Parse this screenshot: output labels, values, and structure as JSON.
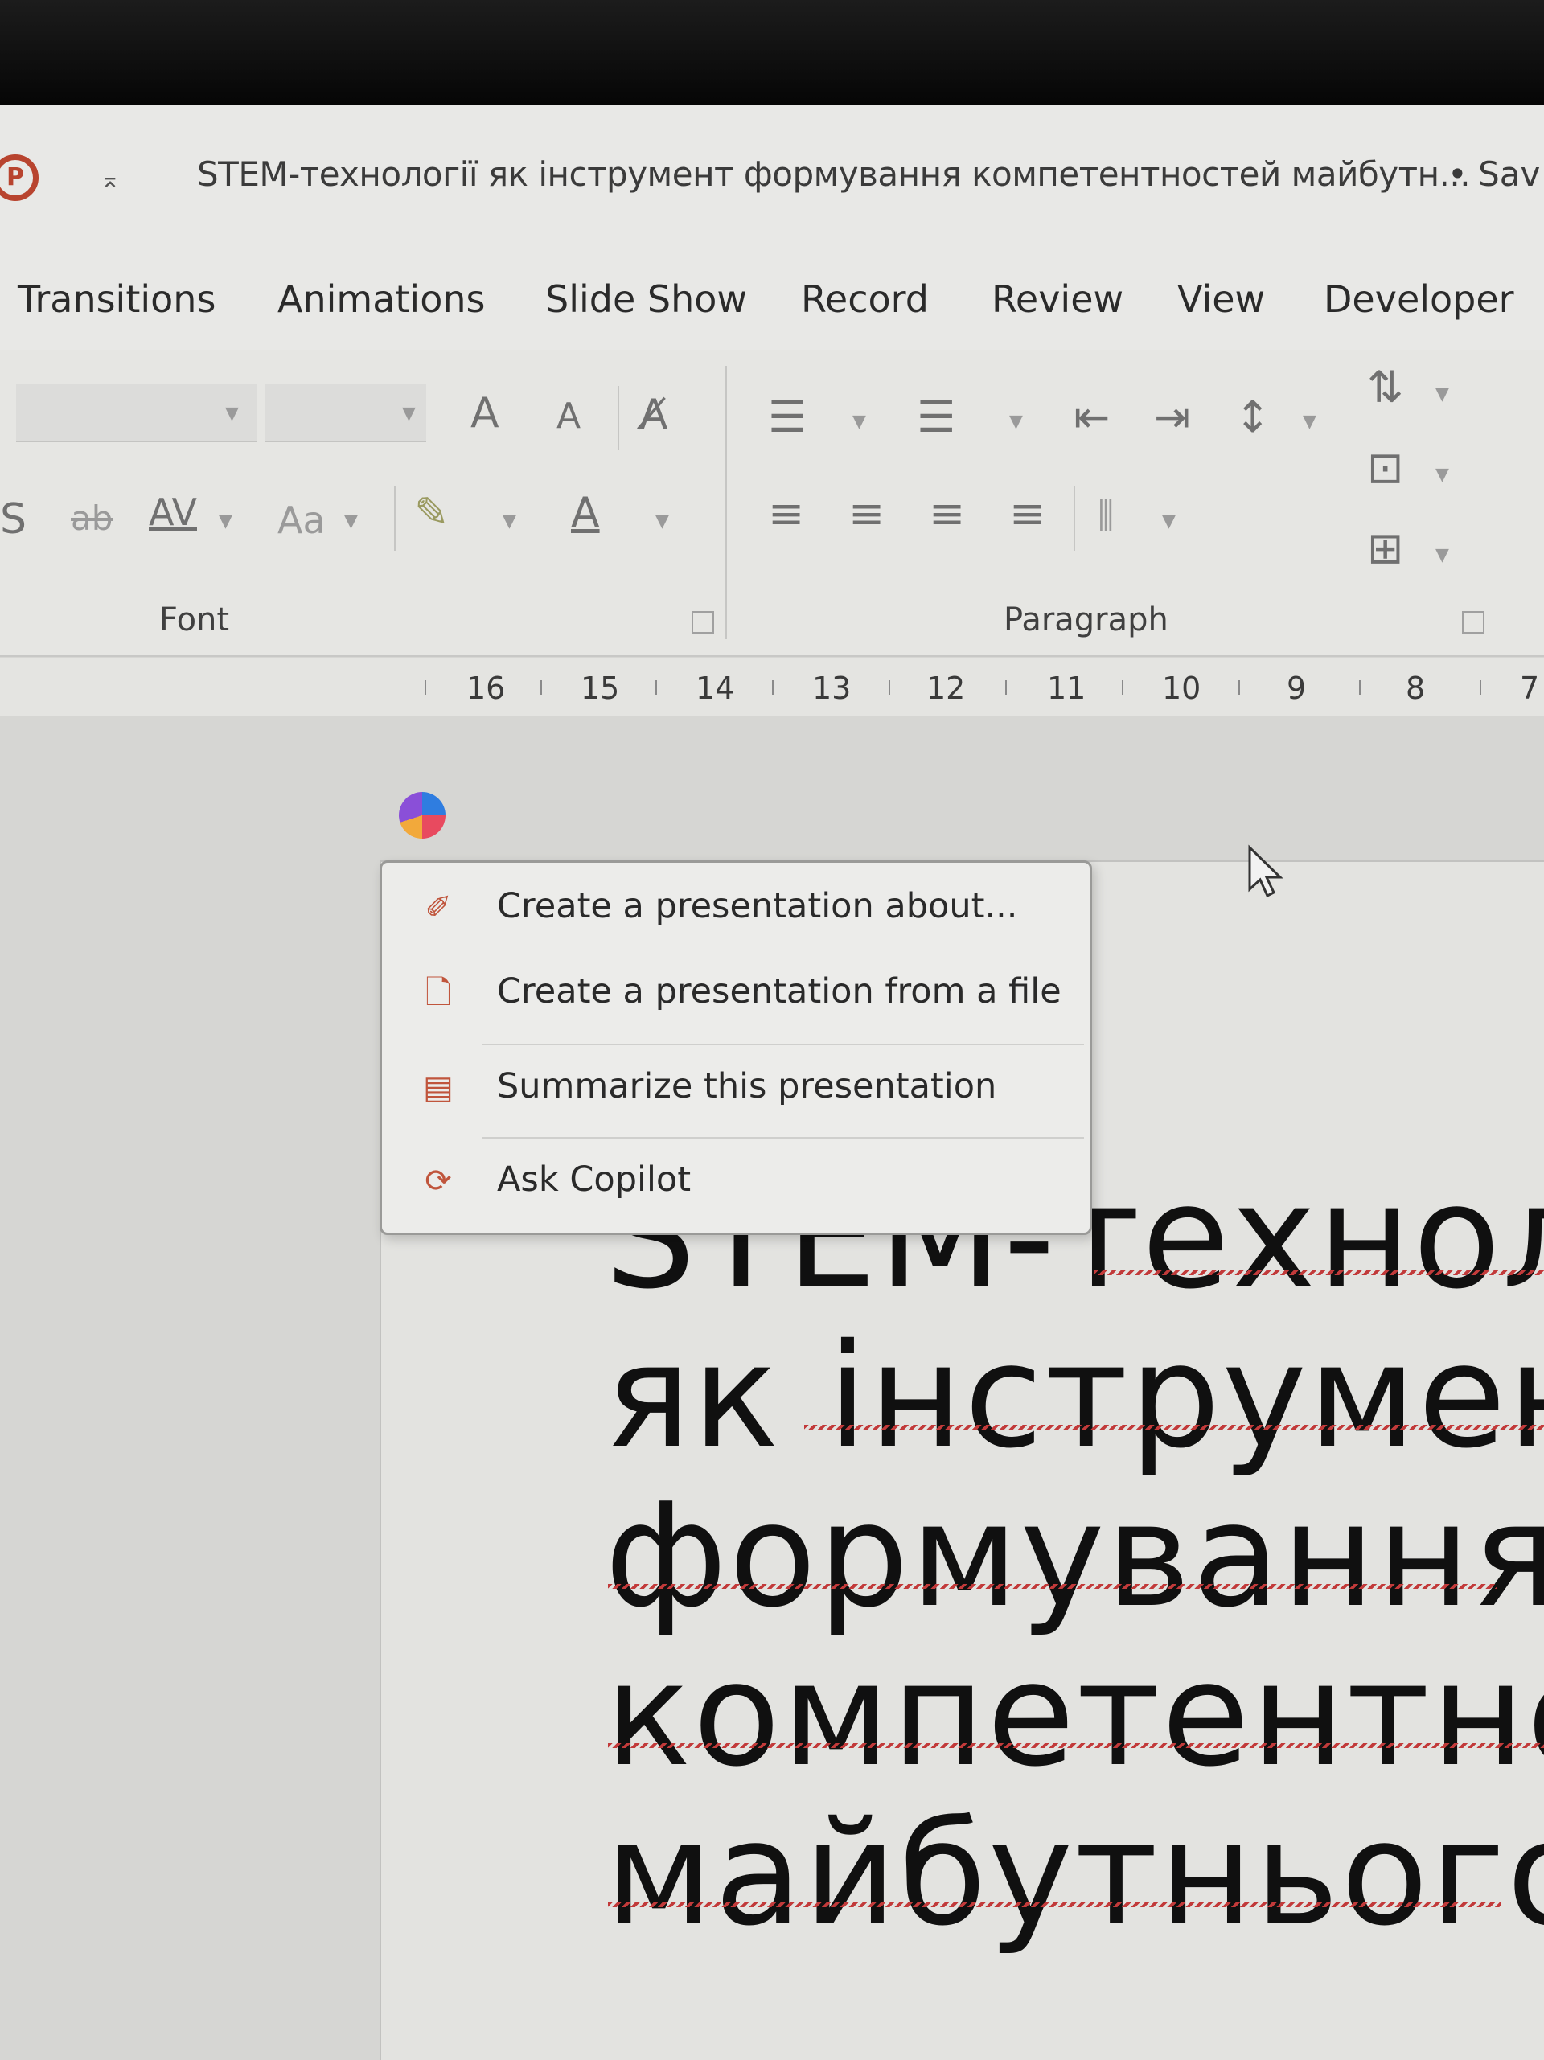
{
  "window": {
    "doc_title": "STEM-технології як інструмент формування компетентностей майбутн...",
    "save_status": "• Sav"
  },
  "tabs": [
    {
      "label": "Transitions"
    },
    {
      "label": "Animations"
    },
    {
      "label": "Slide Show"
    },
    {
      "label": "Record"
    },
    {
      "label": "Review"
    },
    {
      "label": "View"
    },
    {
      "label": "Developer"
    }
  ],
  "ribbon": {
    "font_group_label": "Font",
    "paragraph_group_label": "Paragraph",
    "grow_font": "A",
    "shrink_font": "A",
    "shadow": "S",
    "strikethrough": "ab",
    "char_spacing": "AV",
    "change_case": "Aa",
    "font_color": "A"
  },
  "ruler": {
    "numbers": [
      "16",
      "15",
      "14",
      "13",
      "12",
      "11",
      "10",
      "9",
      "8",
      "7"
    ]
  },
  "copilot_menu": {
    "items": [
      {
        "label": "Create a presentation about...",
        "icon": "pen-sparkle-icon"
      },
      {
        "label": "Create a presentation from a file",
        "icon": "file-icon"
      },
      {
        "label": "Summarize this presentation",
        "icon": "list-icon"
      },
      {
        "label": "Ask Copilot",
        "icon": "copilot-chat-icon"
      }
    ]
  },
  "slide": {
    "title_lines": [
      "STEM-технол",
      "як інструмент",
      "формування",
      "компетентно",
      "майбутнього"
    ]
  },
  "colors": {
    "accent": "#c0553c",
    "spellcheck": "#c23a3a"
  }
}
